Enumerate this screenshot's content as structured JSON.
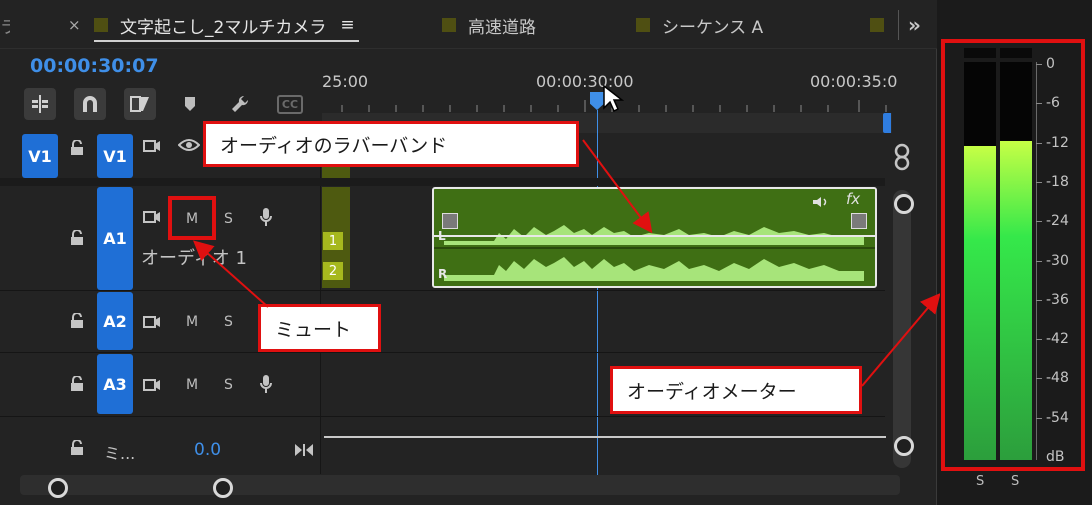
{
  "tabs": {
    "partial": "ラ",
    "close": "×",
    "active": "文字起こし_2マルチカメラ",
    "menu": "≡",
    "tab2": "高速道路",
    "tab3": "シーケンス A",
    "overflow": "»"
  },
  "timecode": "00:00:30:07",
  "ruler": {
    "labels": [
      "25:00",
      "00:00:30:00",
      "00:00:35:0"
    ]
  },
  "tools": {
    "cc_label": "CC"
  },
  "tracks": {
    "v1": {
      "source": "V1",
      "target": "V1"
    },
    "a1": {
      "target": "A1",
      "m": "M",
      "s": "S",
      "name": "オーディオ 1"
    },
    "a2": {
      "target": "A2",
      "m": "M",
      "s": "S"
    },
    "a3": {
      "target": "A3",
      "m": "M",
      "s": "S"
    },
    "master": {
      "name": "ミ...",
      "value": "0.0"
    }
  },
  "clip": {
    "fx_label": "fx",
    "channel_l": "L",
    "channel_r": "R",
    "ch1": "1",
    "ch2": "2"
  },
  "callouts": {
    "rubber_band": "オーディオのラバーバンド",
    "mute": "ミュート",
    "meter": "オーディオメーター"
  },
  "meter": {
    "scale": [
      "0",
      "-6",
      "-12",
      "-18",
      "-24",
      "-30",
      "-36",
      "-42",
      "-48",
      "-54",
      "dB"
    ],
    "solo_left": "S",
    "solo_right": "S",
    "level_left_db": -12.7,
    "level_right_db": -11.9,
    "colors": {
      "top": "#c6ff45",
      "mid": "#35e84a",
      "bottom": "#2c9e3c"
    }
  },
  "colors": {
    "accent_blue": "#1f6fd6",
    "timecode_blue": "#3f8fe8",
    "callout_border": "#e01010",
    "clip_green": "#3f6f14"
  }
}
